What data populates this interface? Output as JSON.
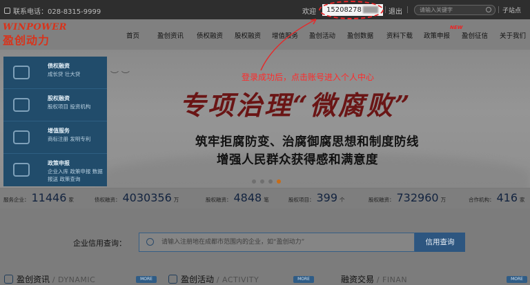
{
  "topbar": {
    "phone": "联系电话：028-8315-9999",
    "welcome": "欢迎",
    "account": "15208278",
    "logout": "退出",
    "search_placeholder": "请输入关键字",
    "site_nav": "子站点"
  },
  "annotation": "登录成功后，点击账号进入个人中心",
  "logo": {
    "en": "WINPOWER",
    "cn": "盈创动力"
  },
  "nav": {
    "items": [
      "首页",
      "盈创资讯",
      "债权融资",
      "股权融资",
      "增值服务",
      "盈创活动",
      "盈创数据",
      "资料下载",
      "政策申报",
      "盈创征信",
      "关于我们"
    ],
    "new_badge": "NEW"
  },
  "banner": {
    "calligraphy": "专项治理“微腐败”",
    "slogan_line1": "筑牢拒腐防变、治腐御腐思想和制度防线",
    "slogan_line2": "增强人民群众获得感和满意度"
  },
  "left_panel": [
    {
      "title": "债权融资",
      "sub": "成长贷  壮大贷"
    },
    {
      "title": "股权融资",
      "sub": "股权项目  投资机构"
    },
    {
      "title": "增值服务",
      "sub": "商标注册  发明专利"
    },
    {
      "title": "政策申报",
      "sub": "企业入库  政策申报  数据报送  政策查询"
    }
  ],
  "stats": [
    {
      "label": "服务企业：",
      "value": "11446",
      "unit": "家"
    },
    {
      "label": "债权融资：",
      "value": "4030356",
      "unit": "万"
    },
    {
      "label": "股权融资：",
      "value": "4848",
      "unit": "笔"
    },
    {
      "label": "股权项目：",
      "value": "399",
      "unit": "个"
    },
    {
      "label": "股权融资：",
      "value": "732960",
      "unit": "万"
    },
    {
      "label": "合作机构：",
      "value": "416",
      "unit": "家"
    }
  ],
  "credit": {
    "label": "企业信用查询：",
    "placeholder": "请输入注册地在成都市范围内的企业，如“盈创动力”",
    "button": "信用查询"
  },
  "sections": [
    {
      "cn": "盈创资讯",
      "en": "/ DYNAMIC"
    },
    {
      "cn": "盈创活动",
      "en": "/ ACTIVITY"
    },
    {
      "cn": "融资交易",
      "en": "/ FINAN"
    }
  ],
  "more_label": "MORE"
}
